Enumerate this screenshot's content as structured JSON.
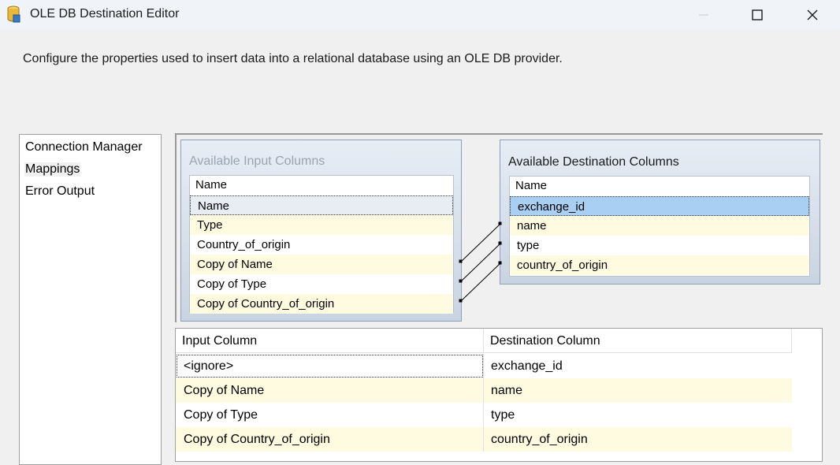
{
  "window": {
    "title": "OLE DB Destination Editor"
  },
  "description": "Configure the properties used to insert data into a relational database using an OLE DB provider.",
  "nav": {
    "items": [
      {
        "label": "Connection Manager",
        "selected": false
      },
      {
        "label": "Mappings",
        "selected": true
      },
      {
        "label": "Error Output",
        "selected": false
      }
    ]
  },
  "input_columns": {
    "title": "Available Input Columns",
    "header": "Name",
    "rows": [
      "Name",
      "Type",
      "Country_of_origin",
      "Copy of Name",
      "Copy of Type",
      "Copy of Country_of_origin"
    ]
  },
  "destination_columns": {
    "title": "Available Destination Columns",
    "header": "Name",
    "rows": [
      "exchange_id",
      "name",
      "type",
      "country_of_origin"
    ]
  },
  "mapping_grid": {
    "headers": [
      "Input Column",
      "Destination Column"
    ],
    "rows": [
      {
        "input": "<ignore>",
        "destination": "exchange_id"
      },
      {
        "input": "Copy of Name",
        "destination": "name"
      },
      {
        "input": "Copy of Type",
        "destination": "type"
      },
      {
        "input": "Copy of Country_of_origin",
        "destination": "country_of_origin"
      }
    ]
  },
  "icons": {
    "app": "database-icon",
    "minimize": "minimize-icon",
    "maximize": "maximize-icon",
    "close": "close-icon"
  },
  "colors": {
    "row_alt": "#fffbe0",
    "selection": "#a9cff2",
    "panel_border": "#8aa0b8"
  }
}
